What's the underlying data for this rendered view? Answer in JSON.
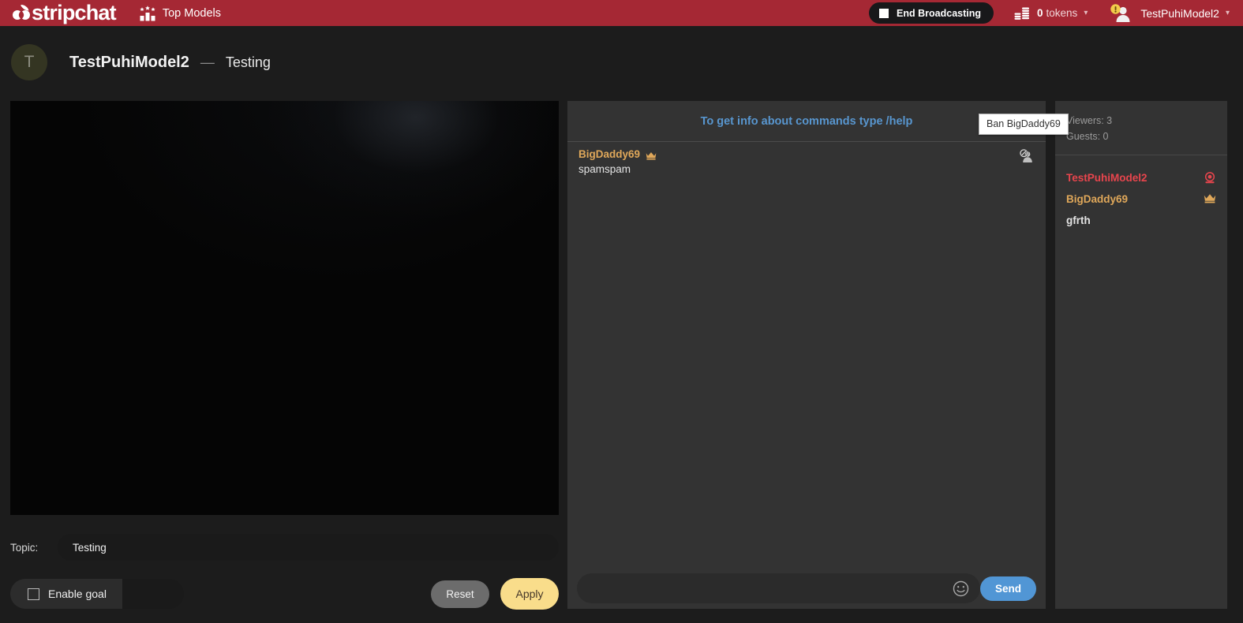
{
  "brand": {
    "name": "stripchat",
    "accent": "#a52834",
    "logo_icon": "stripchat-logo-icon"
  },
  "topbar": {
    "top_models_label": "Top Models",
    "top_models_icon": "podium-stars-icon",
    "end_broadcasting_label": "End Broadcasting",
    "stop_icon": "stop-square-icon",
    "tokens_count": "0",
    "tokens_word": "tokens",
    "tokens_icon": "coin-stack-icon",
    "tokens_caret_icon": "chevron-down-icon",
    "account_name": "TestPuhiModel2",
    "account_icon": "user-avatar-warning-icon",
    "account_caret_icon": "chevron-down-icon"
  },
  "channel": {
    "avatar_initial": "T",
    "avatar_color": "#343522",
    "name": "TestPuhiModel2",
    "separator": "—",
    "topic": "Testing"
  },
  "broadcast": {
    "video_placeholder_icon": "camera-feed-dark"
  },
  "controls": {
    "topic_label": "Topic:",
    "topic_value": "Testing",
    "topic_placeholder": "",
    "enable_goal_label": "Enable goal",
    "enable_goal_checked": false,
    "goal_amount_value": "",
    "goal_amount_placeholder": "",
    "reset_label": "Reset",
    "apply_label": "Apply",
    "apply_color": "#f9dd8b",
    "reset_color": "#6c6c6c"
  },
  "chat": {
    "help_text": "To get info about commands type /help",
    "help_color": "#5896cf",
    "tooltip_text": "Ban BigDaddy69",
    "messages": [
      {
        "user": "BigDaddy69",
        "user_color": "#e0a85a",
        "badge_icon": "crown-icon",
        "text": "spamspam",
        "ban_icon": "user-ban-icon"
      }
    ],
    "input_value": "",
    "input_placeholder": "",
    "emoji_icon": "smiley-face-icon",
    "send_label": "Send",
    "send_color": "#5196d5"
  },
  "users": {
    "viewers_label": "Viewers: 3",
    "guests_label": "Guests: 0",
    "list": [
      {
        "name": "TestPuhiModel2",
        "role": "model",
        "color": "#e8454d",
        "badge_icon": "webcam-icon"
      },
      {
        "name": "BigDaddy69",
        "role": "knight",
        "color": "#e0a85a",
        "badge_icon": "crown-icon"
      },
      {
        "name": "gfrth",
        "role": "plain",
        "color": "#e3e3e3",
        "badge_icon": ""
      }
    ]
  }
}
